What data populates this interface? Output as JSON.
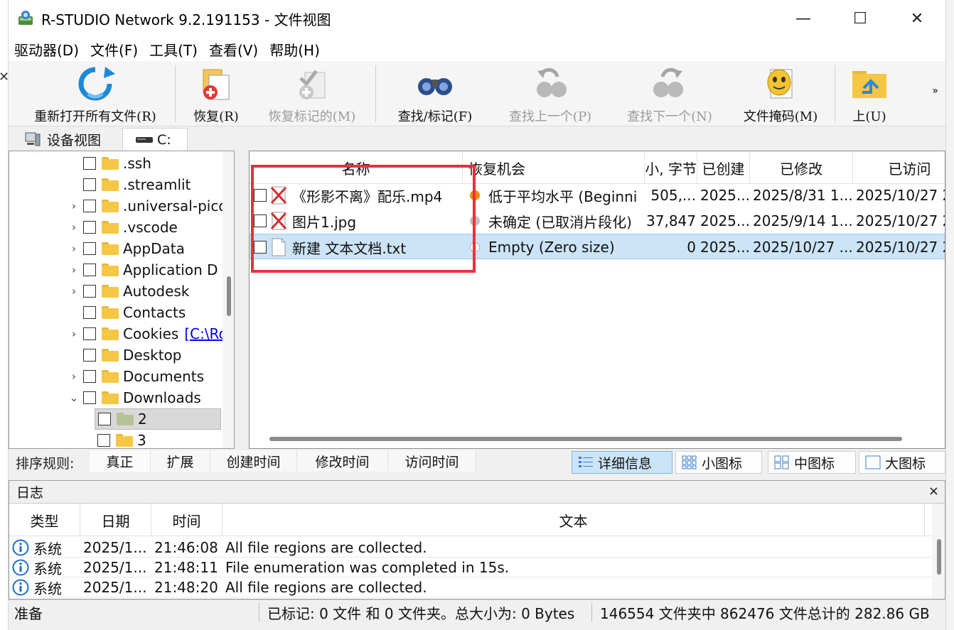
{
  "window": {
    "title": "R-STUDIO Network 9.2.191153 - 文件视图",
    "minimize": "—",
    "maximize": "☐",
    "close": "✕"
  },
  "menu": [
    "驱动器(D)",
    "文件(F)",
    "工具(T)",
    "查看(V)",
    "帮助(H)"
  ],
  "toolbar": {
    "reopen": "重新打开所有文件(R)",
    "recover": "恢复(R)",
    "recover_marked": "恢复标记的(M)",
    "find_mark": "查找/标记(F)",
    "find_prev": "查找上一个(P)",
    "find_next": "查找下一个(N)",
    "file_mask": "文件掩码(M)",
    "up": "上(U)",
    "more": "»"
  },
  "tabs": {
    "device_view": "设备视图",
    "drive": "C:"
  },
  "tree": {
    "items": [
      {
        "name": ".ssh",
        "expandable": false
      },
      {
        "name": ".streamlit",
        "expandable": false
      },
      {
        "name": ".universal-pico",
        "expandable": true
      },
      {
        "name": ".vscode",
        "expandable": true
      },
      {
        "name": "AppData",
        "expandable": true
      },
      {
        "name": "Application D",
        "expandable": true
      },
      {
        "name": "Autodesk",
        "expandable": true
      },
      {
        "name": "Contacts",
        "expandable": false
      },
      {
        "name": "Cookies",
        "expandable": true,
        "link": "[C:\\Ro"
      },
      {
        "name": "Desktop",
        "expandable": false
      },
      {
        "name": "Documents",
        "expandable": true
      },
      {
        "name": "Downloads",
        "expandable": true,
        "expanded": true
      }
    ],
    "children": [
      {
        "name": "2",
        "selected": true
      },
      {
        "name": "3"
      }
    ],
    "expand_glyph": "›",
    "collapse_glyph": "⌄"
  },
  "list": {
    "columns": [
      "名称",
      "恢复机会",
      "大小, 字节",
      "已创建",
      "已修改",
      "已访问"
    ],
    "rows": [
      {
        "name": "《形影不离》配乐.mp4",
        "chance": "低于平均水平 (Beginni",
        "chance_color": "#f08c00",
        "size": "505,...",
        "created": "2025...",
        "modified": "2025/8/31 1...",
        "accessed": "2025/10/27 2",
        "icon": "deleted"
      },
      {
        "name": "图片1.jpg",
        "chance": "未确定 (已取消片段化)",
        "chance_color": "#bfbfbf",
        "size": "37,847",
        "created": "2025...",
        "modified": "2025/9/14 1...",
        "accessed": "2025/10/27 2",
        "icon": "deleted"
      },
      {
        "name": "新建 文本文档.txt",
        "chance": "Empty (Zero size)",
        "chance_color": "#ffffff",
        "size": "0",
        "created": "2025...",
        "modified": "2025/10/27 ...",
        "accessed": "2025/10/27 2",
        "icon": "text",
        "selected": true
      }
    ]
  },
  "sort": {
    "label": "排序规则:",
    "buttons": [
      "真正",
      "扩展",
      "创建时间",
      "修改时间",
      "访问时间"
    ]
  },
  "views": [
    "详细信息",
    "小图标",
    "中图标",
    "大图标"
  ],
  "log": {
    "title": "日志",
    "close": "×",
    "columns": [
      "类型",
      "日期",
      "时间",
      "文本"
    ],
    "rows": [
      {
        "type": "系统",
        "date": "2025/1...",
        "time": "21:46:08",
        "text": "All file regions are collected."
      },
      {
        "type": "系统",
        "date": "2025/1...",
        "time": "21:48:11",
        "text": "File enumeration was completed in 15s."
      },
      {
        "type": "系统",
        "date": "2025/1...",
        "time": "21:48:20",
        "text": "All file regions are collected."
      }
    ]
  },
  "status": {
    "ready": "准备",
    "marked": "已标记: 0 文件 和 0 文件夹。总大小为: 0 Bytes",
    "totals": "146554 文件夹中 862476 文件总计的 282.86 GB"
  },
  "colors": {
    "highlight_box": "#e5323f",
    "selection": "#cce4f7"
  }
}
